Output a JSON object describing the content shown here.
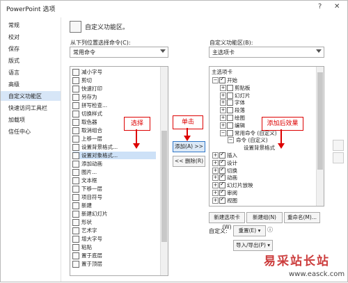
{
  "window": {
    "title": "PowerPoint 选项",
    "help": "?",
    "close": "✕"
  },
  "sidebar": {
    "items": [
      "常规",
      "校对",
      "保存",
      "版式",
      "语言",
      "高级",
      "自定义功能区",
      "快速访问工具栏",
      "加载项",
      "信任中心"
    ],
    "active_index": 6
  },
  "main": {
    "heading": "自定义功能区。",
    "left_label": "从下列位置选择命令(C):",
    "left_value": "常用命令",
    "right_label": "自定义功能区(B):",
    "right_value": "主选项卡",
    "commands": [
      "减小字号",
      "剪切",
      "快速打印",
      "另存为",
      "拼写检查...",
      "切换样式",
      "取色器",
      "取消组合",
      "上移一层",
      "设置背景格式...",
      "设置对象格式...",
      "添加动画",
      "图片...",
      "文本框",
      "下移一层",
      "项目符号",
      "新建",
      "新建幻灯片",
      "形状",
      "艺术字",
      "增大字号",
      "粘贴",
      "置于底层",
      "置于顶层"
    ],
    "selected_command": "设置对象格式...",
    "add_button": "添加(A) >>",
    "remove_button": "<< 删除(R)",
    "callouts": {
      "select": "选择",
      "click": "单击",
      "added": "添加后效果"
    },
    "tree_header": "主选项卡",
    "tree": [
      {
        "level": 0,
        "expander": "⊟",
        "checked": true,
        "label": "开始"
      },
      {
        "level": 1,
        "expander": "⊞",
        "checked": false,
        "label": "剪贴板"
      },
      {
        "level": 1,
        "expander": "⊞",
        "checked": false,
        "label": "幻灯片"
      },
      {
        "level": 1,
        "expander": "⊞",
        "checked": false,
        "label": "字体"
      },
      {
        "level": 1,
        "expander": "⊞",
        "checked": false,
        "label": "段落"
      },
      {
        "level": 1,
        "expander": "⊞",
        "checked": false,
        "label": "绘图"
      },
      {
        "level": 1,
        "expander": "⊞",
        "checked": false,
        "label": "编辑"
      },
      {
        "level": 1,
        "expander": "⊟",
        "checked": false,
        "label": "常用命令 (自定义)"
      },
      {
        "level": 2,
        "expander": "⊟",
        "checked": false,
        "label": "命令 (自定义)"
      },
      {
        "level": 3,
        "expander": "",
        "checked": false,
        "label": "设置背景格式"
      },
      {
        "level": 0,
        "expander": "⊞",
        "checked": true,
        "label": "插入"
      },
      {
        "level": 0,
        "expander": "⊞",
        "checked": true,
        "label": "设计"
      },
      {
        "level": 0,
        "expander": "⊞",
        "checked": true,
        "label": "切换"
      },
      {
        "level": 0,
        "expander": "⊞",
        "checked": true,
        "label": "动画"
      },
      {
        "level": 0,
        "expander": "⊞",
        "checked": true,
        "label": "幻灯片放映"
      },
      {
        "level": 0,
        "expander": "⊞",
        "checked": true,
        "label": "审阅"
      },
      {
        "level": 0,
        "expander": "⊞",
        "checked": true,
        "label": "视图"
      }
    ],
    "new_tab": "新建选项卡(W)",
    "new_group": "新建组(N)",
    "rename": "重命名(M)...",
    "customize_label": "自定义:",
    "reset": "重置(E) ▾",
    "import_export": "导入/导出(P) ▾",
    "info": "ⓘ"
  },
  "watermark": {
    "title": "易采站长站",
    "url": "www.easck.com"
  },
  "colors": {
    "accent": "#2e76c7",
    "callout": "#dd0000",
    "selected": "#cde1f7"
  }
}
